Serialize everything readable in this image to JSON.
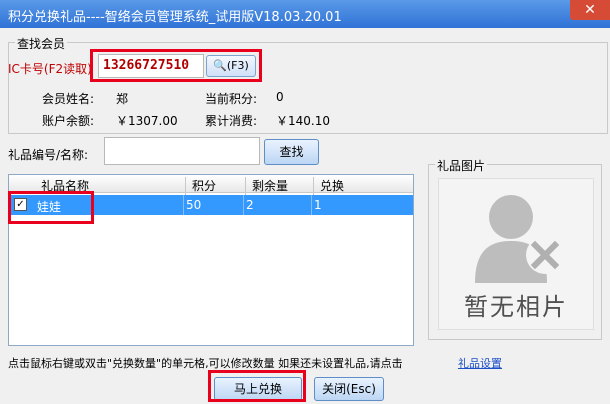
{
  "window": {
    "title": "积分兑换礼品----智络会员管理系统_试用版V18.03.20.01",
    "close_glyph": "✕"
  },
  "member_group": {
    "legend": "查找会员",
    "ic_label": "IC卡号(F2读取)",
    "card_value": "13266727510",
    "read_button": "(F3)",
    "name_label": "会员姓名:",
    "name_value": "郑",
    "points_label": "当前积分:",
    "points_value": "0",
    "balance_label": "账户余额:",
    "balance_value": "￥1307.00",
    "spent_label": "累计消费:",
    "spent_value": "￥140.10"
  },
  "gift_search": {
    "label": "礼品编号/名称:",
    "value": "",
    "search_button": "查找"
  },
  "gift_table": {
    "columns": [
      "礼品名称",
      "积分",
      "剩余量",
      "兑换"
    ],
    "rows": [
      {
        "checked": true,
        "name": "娃娃",
        "points": "50",
        "remaining": "2",
        "exchange": "1"
      }
    ]
  },
  "image_group": {
    "legend": "礼品图片",
    "no_image_text": "暂无相片"
  },
  "hint": {
    "text": "点击鼠标右键或双击\"兑换数量\"的单元格,可以修改数量  如果还未设置礼品,请点击",
    "link": "礼品设置"
  },
  "buttons": {
    "exchange": "马上兑换",
    "close": "关闭(Esc)"
  },
  "highlight_color": "#e8001c",
  "selection_color": "#3399ff"
}
